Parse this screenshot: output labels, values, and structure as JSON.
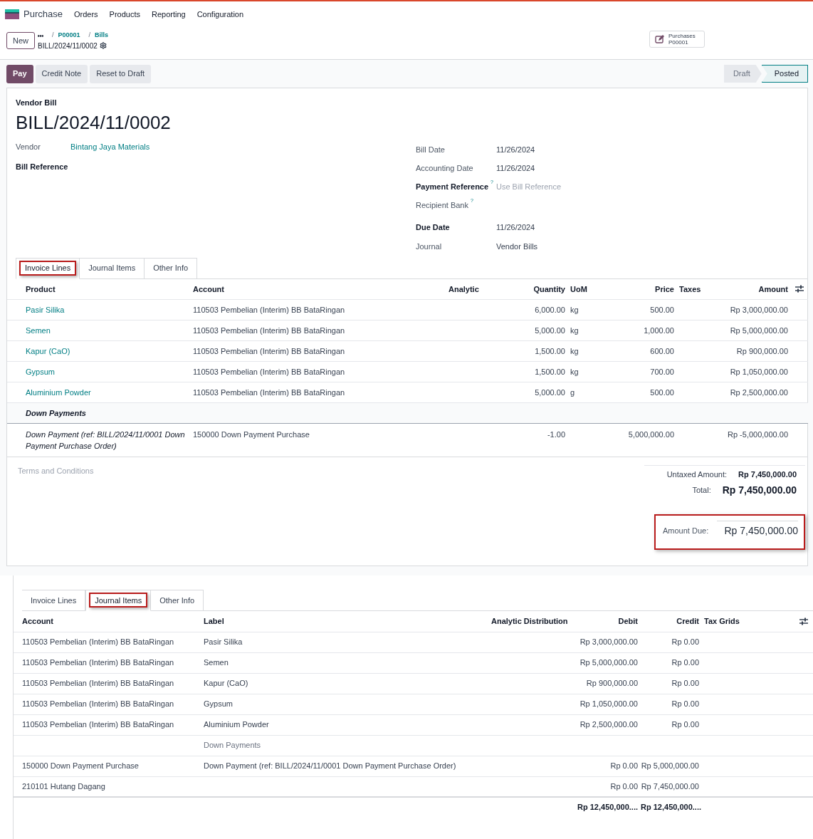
{
  "navbar": {
    "app": "Purchase",
    "menu": [
      "Orders",
      "Products",
      "Reporting",
      "Configuration"
    ]
  },
  "control_panel": {
    "new_button": "New",
    "separator": "/",
    "breadcrumbs": [
      "P00001",
      "Bills"
    ],
    "record": "BILL/2024/11/0002",
    "smart_button": {
      "label": "Purchases",
      "value": "P00001"
    }
  },
  "actions": [
    {
      "label": "Pay",
      "primary": true
    },
    {
      "label": "Credit Note",
      "primary": false
    },
    {
      "label": "Reset to Draft",
      "primary": false
    }
  ],
  "status": [
    {
      "label": "Draft",
      "selected": false
    },
    {
      "label": "Posted",
      "selected": true
    }
  ],
  "bill": {
    "type": "Vendor Bill",
    "number": "BILL/2024/11/0002",
    "left_fields": [
      {
        "label": "Vendor",
        "value": "Bintang Jaya Materials",
        "bold": false
      },
      {
        "label": "Bill Reference",
        "bold": true
      }
    ],
    "right_fields": [
      {
        "label": "Bill Date",
        "value": "11/26/2024",
        "bold": false
      },
      {
        "label": "Accounting Date",
        "value": "11/26/2024",
        "bold": false
      },
      {
        "label": "Payment Reference",
        "help": "?",
        "placeholder": "Use Bill Reference",
        "bold": true
      },
      {
        "label": "Recipient Bank",
        "help": "?",
        "bold": false
      },
      {
        "label": "Due Date",
        "value": "11/26/2024",
        "bold": true
      },
      {
        "label": "Journal",
        "value": "Vendor Bills",
        "bold": false
      }
    ]
  },
  "invoice_tabs": [
    {
      "label": "Invoice Lines",
      "selected": true,
      "highlighted": true
    },
    {
      "label": "Journal Items",
      "selected": false,
      "highlighted": false
    },
    {
      "label": "Other Info",
      "selected": false,
      "highlighted": false
    }
  ],
  "invoice_table": {
    "columns": [
      "Product",
      "Account",
      "Analytic",
      "Quantity",
      "UoM",
      "Price",
      "Taxes",
      "Amount"
    ],
    "rows": [
      {
        "kind": "line",
        "product": "Pasir Silika",
        "account": "110503 Pembelian (Interim) BB BataRingan",
        "quantity": "6,000.00",
        "uom": "kg",
        "price": "500.00",
        "amount": "Rp 3,000,000.00"
      },
      {
        "kind": "line",
        "product": "Semen",
        "account": "110503 Pembelian (Interim) BB BataRingan",
        "quantity": "5,000.00",
        "uom": "kg",
        "price": "1,000.00",
        "amount": "Rp 5,000,000.00"
      },
      {
        "kind": "line",
        "product": "Kapur (CaO)",
        "account": "110503 Pembelian (Interim) BB BataRingan",
        "quantity": "1,500.00",
        "uom": "kg",
        "price": "600.00",
        "amount": "Rp 900,000.00"
      },
      {
        "kind": "line",
        "product": "Gypsum",
        "account": "110503 Pembelian (Interim) BB BataRingan",
        "quantity": "1,500.00",
        "uom": "kg",
        "price": "700.00",
        "amount": "Rp 1,050,000.00"
      },
      {
        "kind": "line",
        "product": "Aluminium Powder",
        "account": "110503 Pembelian (Interim) BB BataRingan",
        "quantity": "5,000.00",
        "uom": "g",
        "price": "500.00",
        "amount": "Rp 2,500,000.00"
      },
      {
        "kind": "section",
        "product": "Down Payments"
      },
      {
        "kind": "down_payment",
        "product": "Down Payment (ref: BILL/2024/11/0001 Down Payment Purchase Order)",
        "account": "150000 Down Payment Purchase",
        "quantity": "-1.00",
        "price": "5,000,000.00",
        "amount": "Rp -5,000,000.00"
      }
    ]
  },
  "terms_placeholder": "Terms and Conditions",
  "totals": [
    {
      "label": "Untaxed Amount:",
      "value": "Rp 7,450,000.00",
      "kind": "subtotal"
    },
    {
      "label": "Total:",
      "value": "Rp 7,450,000.00",
      "kind": "total"
    }
  ],
  "amount_due": {
    "label": "Amount Due:",
    "value": "Rp 7,450,000.00",
    "highlighted": true
  },
  "journal_tabs": [
    {
      "label": "Invoice Lines",
      "selected": false,
      "highlighted": false
    },
    {
      "label": "Journal Items",
      "selected": true,
      "highlighted": true
    },
    {
      "label": "Other Info",
      "selected": false,
      "highlighted": false
    }
  ],
  "journal_table": {
    "columns": [
      "Account",
      "Label",
      "Analytic Distribution",
      "Debit",
      "Credit",
      "Tax Grids"
    ],
    "rows": [
      {
        "kind": "line",
        "account": "110503 Pembelian (Interim) BB BataRingan",
        "label": "Pasir Silika",
        "debit": "Rp 3,000,000.00",
        "credit": "Rp 0.00"
      },
      {
        "kind": "line",
        "account": "110503 Pembelian (Interim) BB BataRingan",
        "label": "Semen",
        "debit": "Rp 5,000,000.00",
        "credit": "Rp 0.00"
      },
      {
        "kind": "line",
        "account": "110503 Pembelian (Interim) BB BataRingan",
        "label": "Kapur (CaO)",
        "debit": "Rp 900,000.00",
        "credit": "Rp 0.00"
      },
      {
        "kind": "line",
        "account": "110503 Pembelian (Interim) BB BataRingan",
        "label": "Gypsum",
        "debit": "Rp 1,050,000.00",
        "credit": "Rp 0.00"
      },
      {
        "kind": "line",
        "account": "110503 Pembelian (Interim) BB BataRingan",
        "label": "Aluminium Powder",
        "debit": "Rp 2,500,000.00",
        "credit": "Rp 0.00"
      },
      {
        "kind": "section",
        "label": "Down Payments"
      },
      {
        "kind": "line",
        "account": "150000 Down Payment Purchase",
        "label": "Down Payment (ref: BILL/2024/11/0001 Down Payment Purchase Order)",
        "debit": "Rp 0.00",
        "credit": "Rp 5,000,000.00"
      },
      {
        "kind": "line",
        "account": "210101 Hutang Dagang",
        "debit": "Rp 0.00",
        "credit": "Rp 7,450,000.00"
      }
    ],
    "totals": {
      "debit": "Rp 12,450,000....",
      "credit": "Rp 12,450,000...."
    }
  }
}
